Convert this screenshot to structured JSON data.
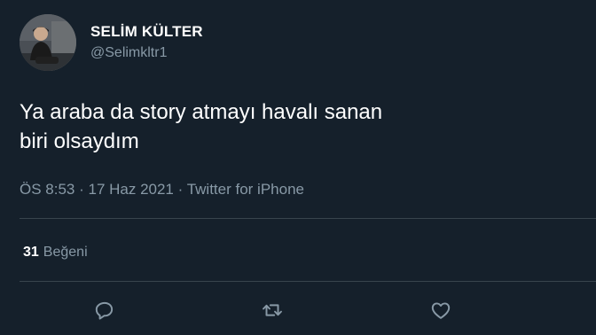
{
  "author": {
    "display_name": "SELİM KÜLTER",
    "handle": "@Selimkltr1"
  },
  "tweet": {
    "text_line1": "Ya araba da story atmayı havalı sanan",
    "text_line2": "biri olsaydım"
  },
  "meta": {
    "time": "ÖS 8:53",
    "sep1": " · ",
    "date": "17 Haz 2021",
    "sep2": " · ",
    "source": "Twitter for iPhone"
  },
  "stats": {
    "likes_count": "31",
    "likes_label": "Beğeni"
  },
  "actions": {
    "reply_icon": "reply-icon",
    "retweet_icon": "retweet-icon",
    "like_icon": "heart-icon"
  },
  "colors": {
    "background": "#15202b",
    "text_primary": "#ffffff",
    "text_secondary": "#8899a6",
    "divider": "#38444d"
  }
}
